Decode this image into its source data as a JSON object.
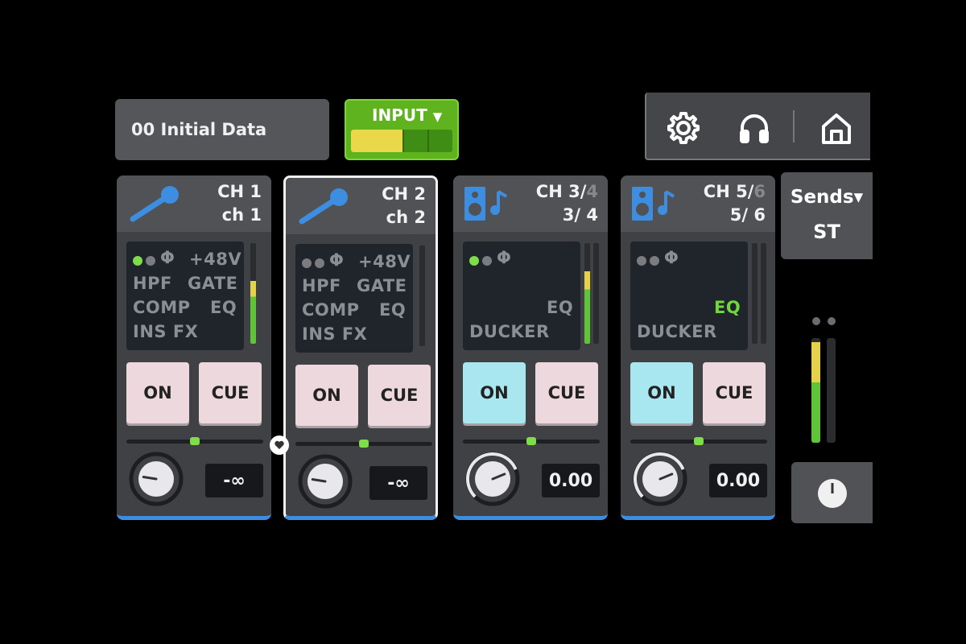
{
  "scene": {
    "label": "00  Initial Data"
  },
  "input_selector": {
    "label": "INPUT",
    "arrow": "▼"
  },
  "toolbar": {
    "icons": [
      "gear-icon",
      "headphones-icon",
      "home-icon"
    ]
  },
  "channels": [
    {
      "id": "CH 1",
      "id_suffix": "",
      "name": "ch 1",
      "icon": "microphone-icon",
      "indicators": {
        "line1": "+48V",
        "line2_a": "HPF",
        "line2_b": "GATE",
        "line3_a": "COMP",
        "line3_b": "EQ",
        "line4": "INS FX",
        "phase": "Φ"
      },
      "on_label": "ON",
      "cue_label": "CUE",
      "on_active": false,
      "value": "-∞",
      "meter_level": 0.62,
      "pan_position": 0.5,
      "knob_level": 0.2
    },
    {
      "id": "CH 2",
      "id_suffix": "",
      "name": "ch 2",
      "icon": "microphone-icon",
      "indicators": {
        "line1": "+48V",
        "line2_a": "HPF",
        "line2_b": "GATE",
        "line3_a": "COMP",
        "line3_b": "EQ",
        "line4": "INS FX",
        "phase": "Φ"
      },
      "on_label": "ON",
      "cue_label": "CUE",
      "on_active": false,
      "value": "-∞",
      "meter_level": 0.0,
      "pan_position": 0.5,
      "knob_level": 0.2
    },
    {
      "id": "CH 3/",
      "id_suffix": "4",
      "name": "3/ 4",
      "icon": "speaker-music-icon",
      "indicators": {
        "phase": "Φ",
        "eq": "EQ",
        "ducker": "DUCKER"
      },
      "on_label": "ON",
      "cue_label": "CUE",
      "on_active": true,
      "value": "0.00",
      "meter_level": 0.72,
      "pan_position": 0.5,
      "knob_level": 0.75
    },
    {
      "id": "CH 5/",
      "id_suffix": "6",
      "name": "5/ 6",
      "icon": "speaker-music-icon",
      "indicators": {
        "phase": "Φ",
        "eq": "EQ",
        "ducker": "DUCKER"
      },
      "on_label": "ON",
      "cue_label": "CUE",
      "on_active": true,
      "value": "0.00",
      "meter_level": 0.0,
      "pan_position": 0.5,
      "knob_level": 0.75
    }
  ],
  "sends": {
    "label": "Sends",
    "arrow": "▾",
    "target": "ST"
  },
  "stereo_meter": {
    "left_level": 0.96,
    "right_level": 0.0
  },
  "colors": {
    "accent_green": "#5fb31e",
    "meter_yellow": "#e6d24a",
    "meter_green": "#5fc43a",
    "on_active": "#a8e6f0",
    "strip_underline": "#3d8ee0"
  }
}
